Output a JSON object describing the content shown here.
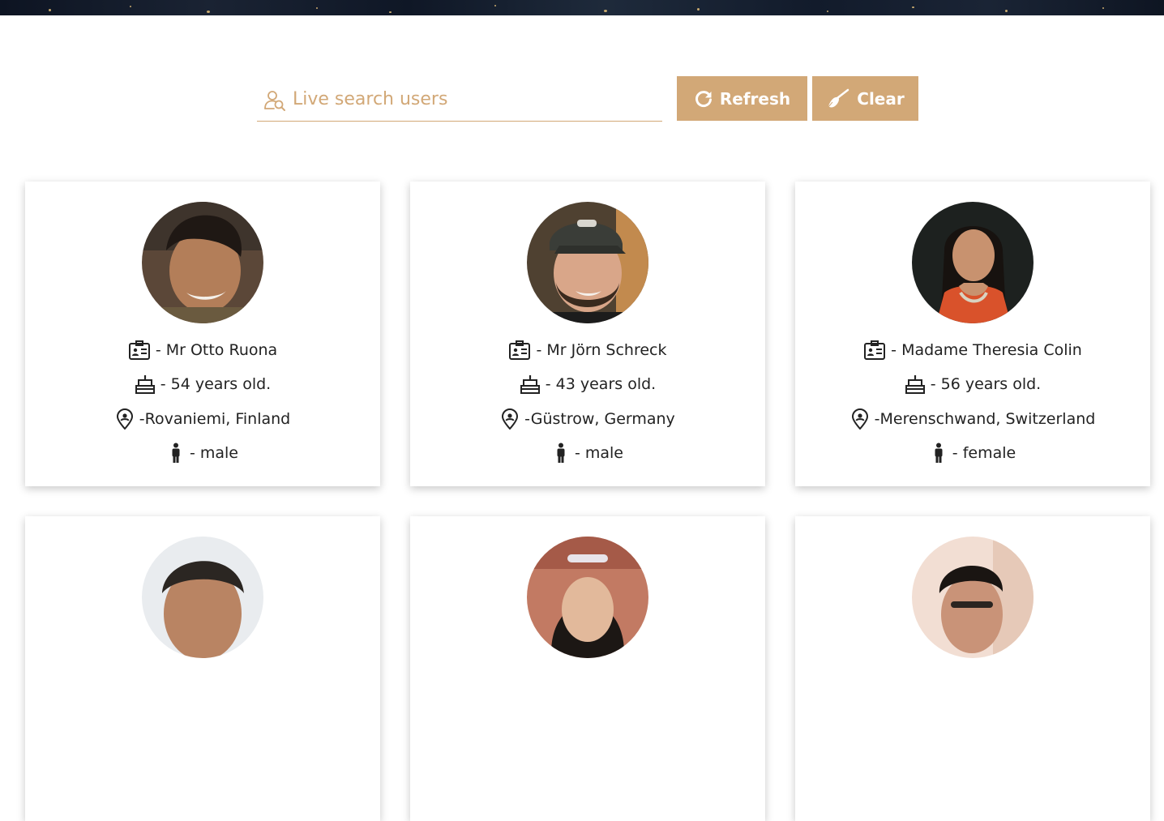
{
  "search": {
    "placeholder": "Live search users"
  },
  "buttons": {
    "refresh_label": "Refresh",
    "clear_label": "Clear"
  },
  "colors": {
    "accent": "#d2a877",
    "text": "#222222"
  },
  "icons": {
    "search": "user-search-icon",
    "refresh": "refresh-icon",
    "clear": "broom-icon",
    "name": "id-card-icon",
    "age": "cake-icon",
    "location": "map-pin-icon",
    "gender": "person-icon"
  },
  "users": [
    {
      "name": "- Mr Otto Ruona",
      "age": "- 54 years old.",
      "location": "-Rovaniemi, Finland",
      "gender": "- male"
    },
    {
      "name": "- Mr Jörn Schreck",
      "age": "- 43 years old.",
      "location": "-Güstrow, Germany",
      "gender": "- male"
    },
    {
      "name": "- Madame Theresia Colin",
      "age": "- 56 years old.",
      "location": "-Merenschwand, Switzerland",
      "gender": "- female"
    }
  ]
}
